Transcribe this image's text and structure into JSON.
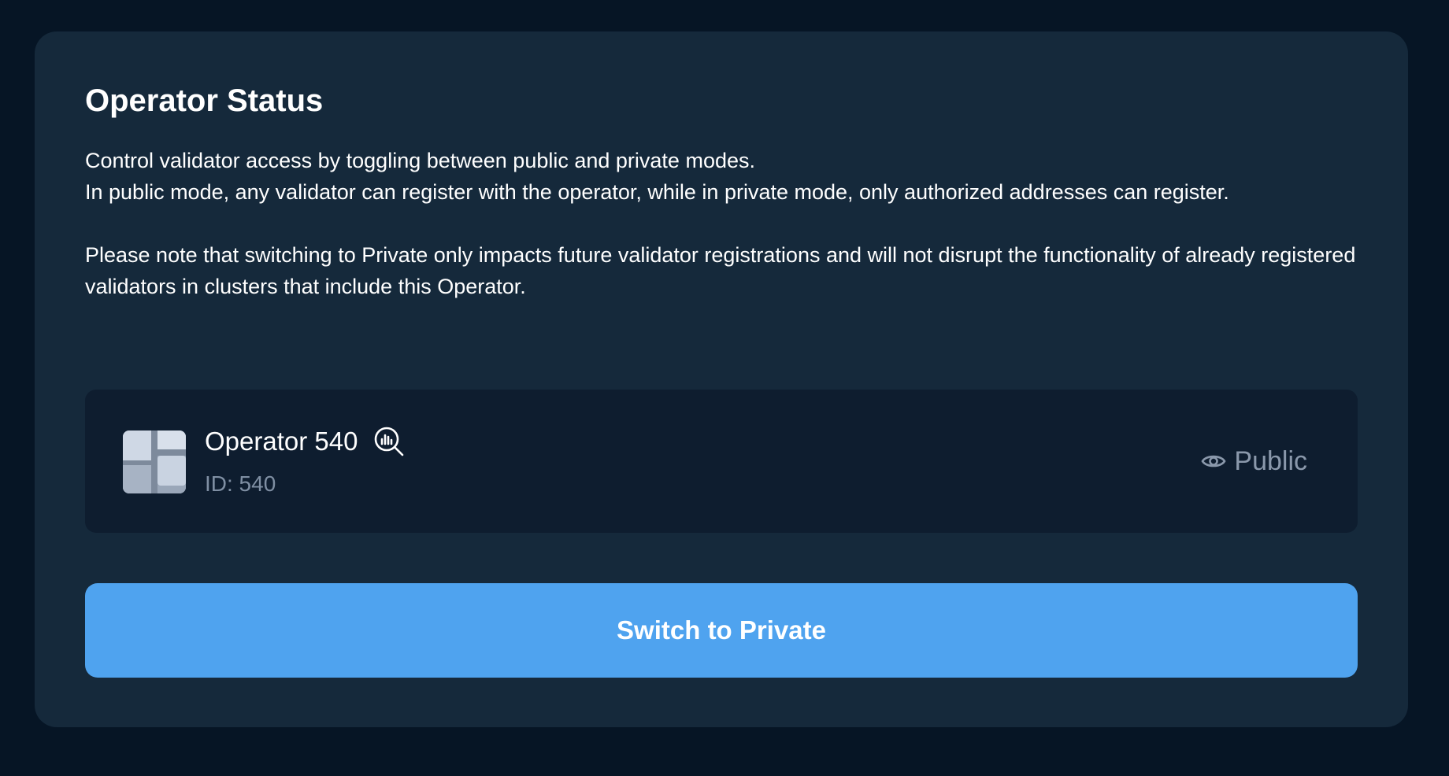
{
  "card": {
    "title": "Operator Status",
    "description": {
      "line1": "Control validator access by toggling between public and private modes.",
      "line2": "In public mode, any validator can register with the operator, while in private mode, only authorized addresses can register.",
      "line3": "Please note that switching to Private only impacts future validator registrations and will not disrupt the functionality of already registered validators in clusters that include this Operator."
    }
  },
  "operator": {
    "name": "Operator 540",
    "id_text": "ID: 540",
    "avatar_icon": "operator-logo-icon",
    "explorer_icon": "explorer-chart-search-icon",
    "status_label": "Public",
    "status_icon": "eye-icon"
  },
  "actions": {
    "switch_label": "Switch to Private"
  },
  "colors": {
    "background": "#061525",
    "card": "#15293b",
    "operator_box": "#0e1d2f",
    "accent": "#4fa3ef",
    "muted_text": "#8a98ab"
  }
}
